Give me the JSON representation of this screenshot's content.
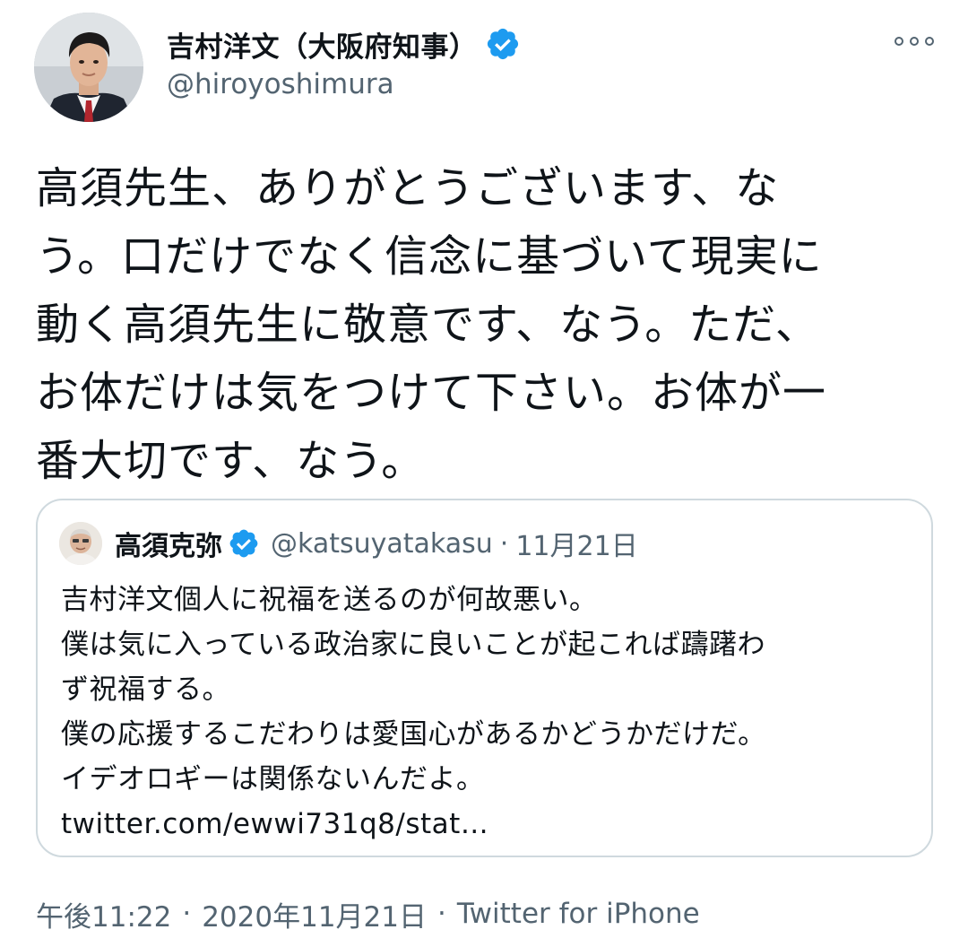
{
  "tweet": {
    "author": {
      "display_name": "吉村洋文（大阪府知事）",
      "handle": "@hiroyoshimura",
      "verified": true
    },
    "more_icon": "more-horizontal-icon",
    "text": "高須先生、ありがとうございます、な\nう。口だけでなく信念に基づいて現実に\n動く高須先生に敬意です、なう。ただ、\nお体だけは気をつけて下さい。お体が一\n番大切です、なう。",
    "quoted": {
      "display_name": "高須克弥",
      "handle": "@katsuyatakasu",
      "separator": "·",
      "date": "11月21日",
      "verified": true,
      "lines": [
        "吉村洋文個人に祝福を送るのが何故悪い。",
        "僕は気に入っている政治家に良いことが起これば躊躇わ",
        "ず祝福する。",
        "僕の応援するこだわりは愛国心があるかどうかだけだ。",
        "イデオロギーは関係ないんだよ。",
        "twitter.com/ewwi731q8/stat…"
      ]
    },
    "footer": {
      "time": "午後11:22",
      "separator1": "·",
      "date": "2020年11月21日",
      "separator2": "·",
      "source": "Twitter for iPhone"
    }
  },
  "colors": {
    "text_primary": "#0f1419",
    "text_secondary": "#536471",
    "verified_blue": "#1d9bf0",
    "border": "#cfd9de"
  }
}
